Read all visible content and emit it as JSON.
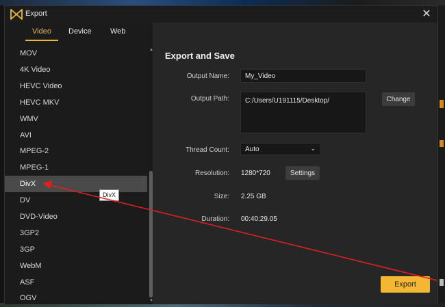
{
  "window": {
    "title": "Export",
    "close_glyph": "✕"
  },
  "tabs": [
    {
      "label": "Video",
      "active": true
    },
    {
      "label": "Device",
      "active": false
    },
    {
      "label": "Web",
      "active": false
    }
  ],
  "formats": [
    {
      "label": "MOV"
    },
    {
      "label": "4K Video"
    },
    {
      "label": "HEVC Video"
    },
    {
      "label": "HEVC MKV"
    },
    {
      "label": "WMV"
    },
    {
      "label": "AVI"
    },
    {
      "label": "MPEG-2"
    },
    {
      "label": "MPEG-1"
    },
    {
      "label": "DivX",
      "selected": true
    },
    {
      "label": "DV"
    },
    {
      "label": "DVD-Video"
    },
    {
      "label": "3GP2"
    },
    {
      "label": "3GP"
    },
    {
      "label": "WebM"
    },
    {
      "label": "ASF"
    },
    {
      "label": "OGV"
    }
  ],
  "tooltip": "DivX",
  "panel": {
    "heading": "Export and Save",
    "output_name_label": "Output Name:",
    "output_name_value": "My_Video",
    "output_path_label": "Output Path:",
    "output_path_value": "C:/Users/U191115/Desktop/",
    "change_label": "Change",
    "thread_count_label": "Thread Count:",
    "thread_count_value": "Auto",
    "resolution_label": "Resolution:",
    "resolution_value": "1280*720",
    "settings_label": "Settings",
    "size_label": "Size:",
    "size_value": "2.25 GB",
    "duration_label": "Duration:",
    "duration_value": "00:40:29.05"
  },
  "export_label": "Export",
  "colors": {
    "accent": "#f4b731",
    "annotation": "#e02020",
    "selected_row": "#4a4a4a"
  }
}
